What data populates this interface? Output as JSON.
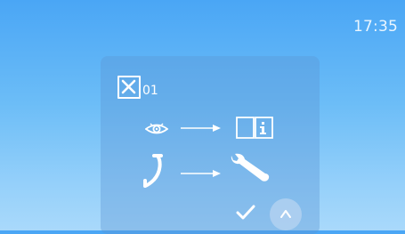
{
  "status_bar": {
    "time": "17:35"
  },
  "error_panel": {
    "code": "01",
    "icons": {
      "error": "close-box-icon",
      "view": "eye-icon",
      "manual": "book-info-icon",
      "call": "phone-handset-icon",
      "service": "wrench-icon",
      "confirm": "checkmark-icon",
      "scroll_up": "chevron-up-icon"
    }
  },
  "colors": {
    "background_top": "#4aa6f5",
    "background_bottom": "#a9d9fb",
    "foreground": "#ffffff"
  }
}
